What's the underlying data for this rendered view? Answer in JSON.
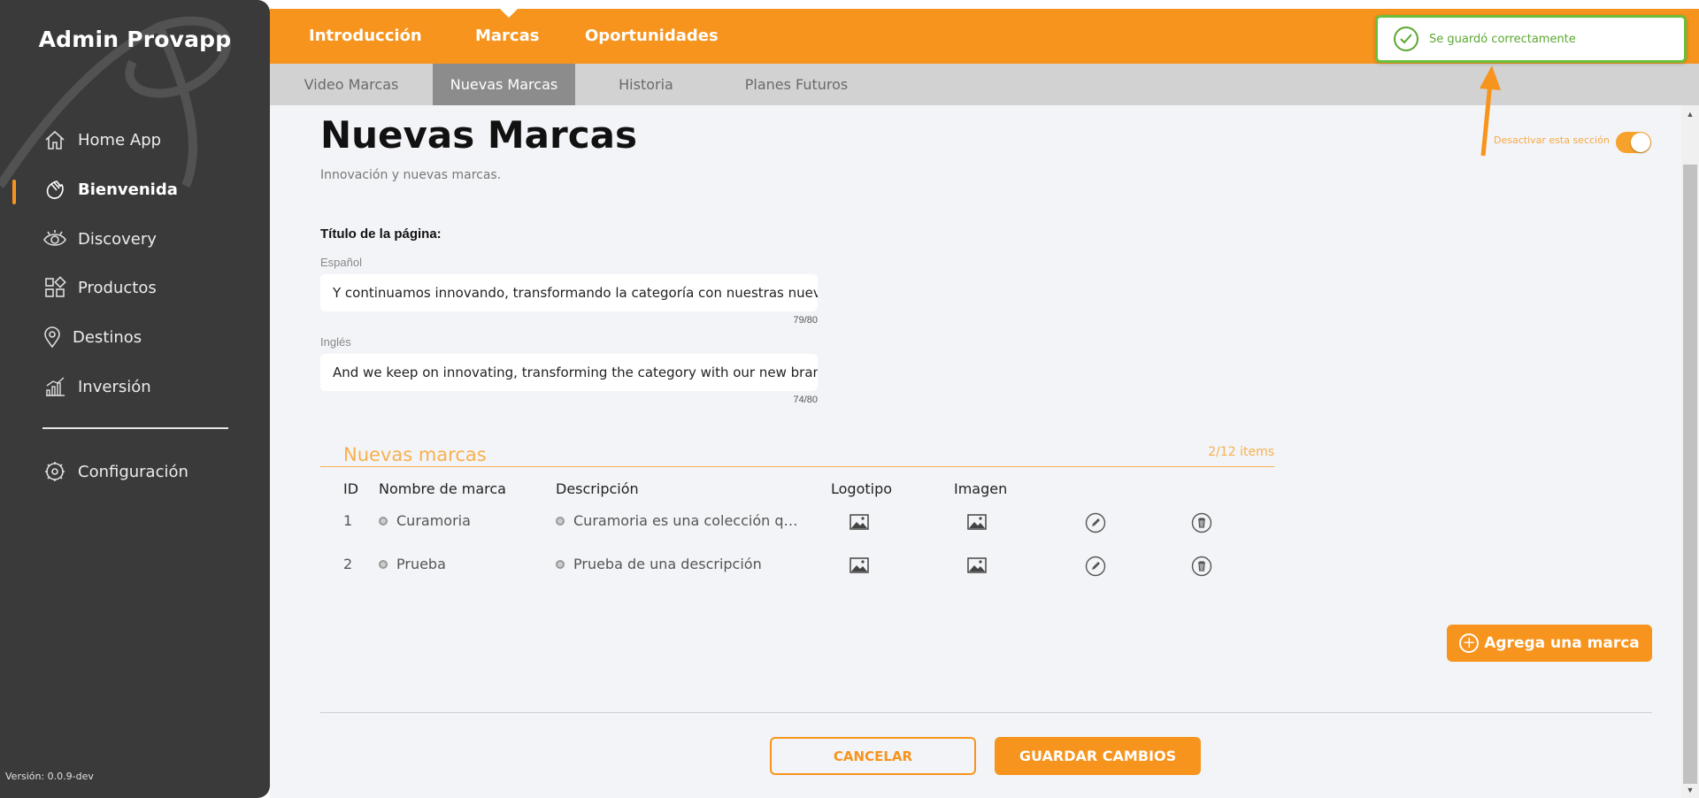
{
  "sidebar": {
    "brand": "Admin Provapp",
    "items": [
      {
        "label": "Home App",
        "icon": "home-icon"
      },
      {
        "label": "Bienvenida",
        "icon": "waving-hand-icon",
        "active": true
      },
      {
        "label": "Discovery",
        "icon": "eye-icon"
      },
      {
        "label": "Productos",
        "icon": "products-grid-icon"
      },
      {
        "label": "Destinos",
        "icon": "map-pin-icon"
      },
      {
        "label": "Inversión",
        "icon": "bar-chart-icon"
      },
      {
        "label": "Configuración",
        "icon": "gear-icon"
      }
    ],
    "version": "Versión: 0.0.9-dev"
  },
  "top_tabs": [
    {
      "label": "Introducción"
    },
    {
      "label": "Marcas",
      "active": true
    },
    {
      "label": "Oportunidades"
    }
  ],
  "sub_tabs": [
    {
      "label": "Video Marcas"
    },
    {
      "label": "Nuevas Marcas",
      "active": true
    },
    {
      "label": "Historia"
    },
    {
      "label": "Planes Futuros"
    }
  ],
  "page": {
    "title": "Nuevas Marcas",
    "subtitle": "Innovación y nuevas marcas.",
    "toggle_label": "Desactivar esta sección",
    "toggle_on": true
  },
  "page_title_field": {
    "heading": "Título de la página:",
    "spanish_label": "Español",
    "spanish_value": "Y continuamos innovando, transformando la categoría con nuestras nuevas marcas.",
    "spanish_count": "79/80",
    "english_label": "Inglés",
    "english_value": "And we keep on innovating, transforming the category with our new brands.",
    "english_count": "74/80"
  },
  "brands": {
    "title": "Nuevas marcas",
    "count": "2/12 items",
    "headers": {
      "id": "ID",
      "name": "Nombre de marca",
      "desc": "Descripción",
      "logo": "Logotipo",
      "image": "Imagen"
    },
    "rows": [
      {
        "id": "1",
        "name": "Curamoria",
        "desc": "Curamoria es una colección q…"
      },
      {
        "id": "2",
        "name": "Prueba",
        "desc": "Prueba de una descripción"
      }
    ],
    "add_label": "Agrega una marca"
  },
  "actions": {
    "cancel": "CANCELAR",
    "save": "GUARDAR CAMBIOS"
  },
  "toast": {
    "message": "Se guardó correctamente",
    "color": "#5aa832"
  },
  "colors": {
    "accent": "#f7941d",
    "sidebar": "#3a3a3a",
    "success": "#6bbf3a"
  }
}
